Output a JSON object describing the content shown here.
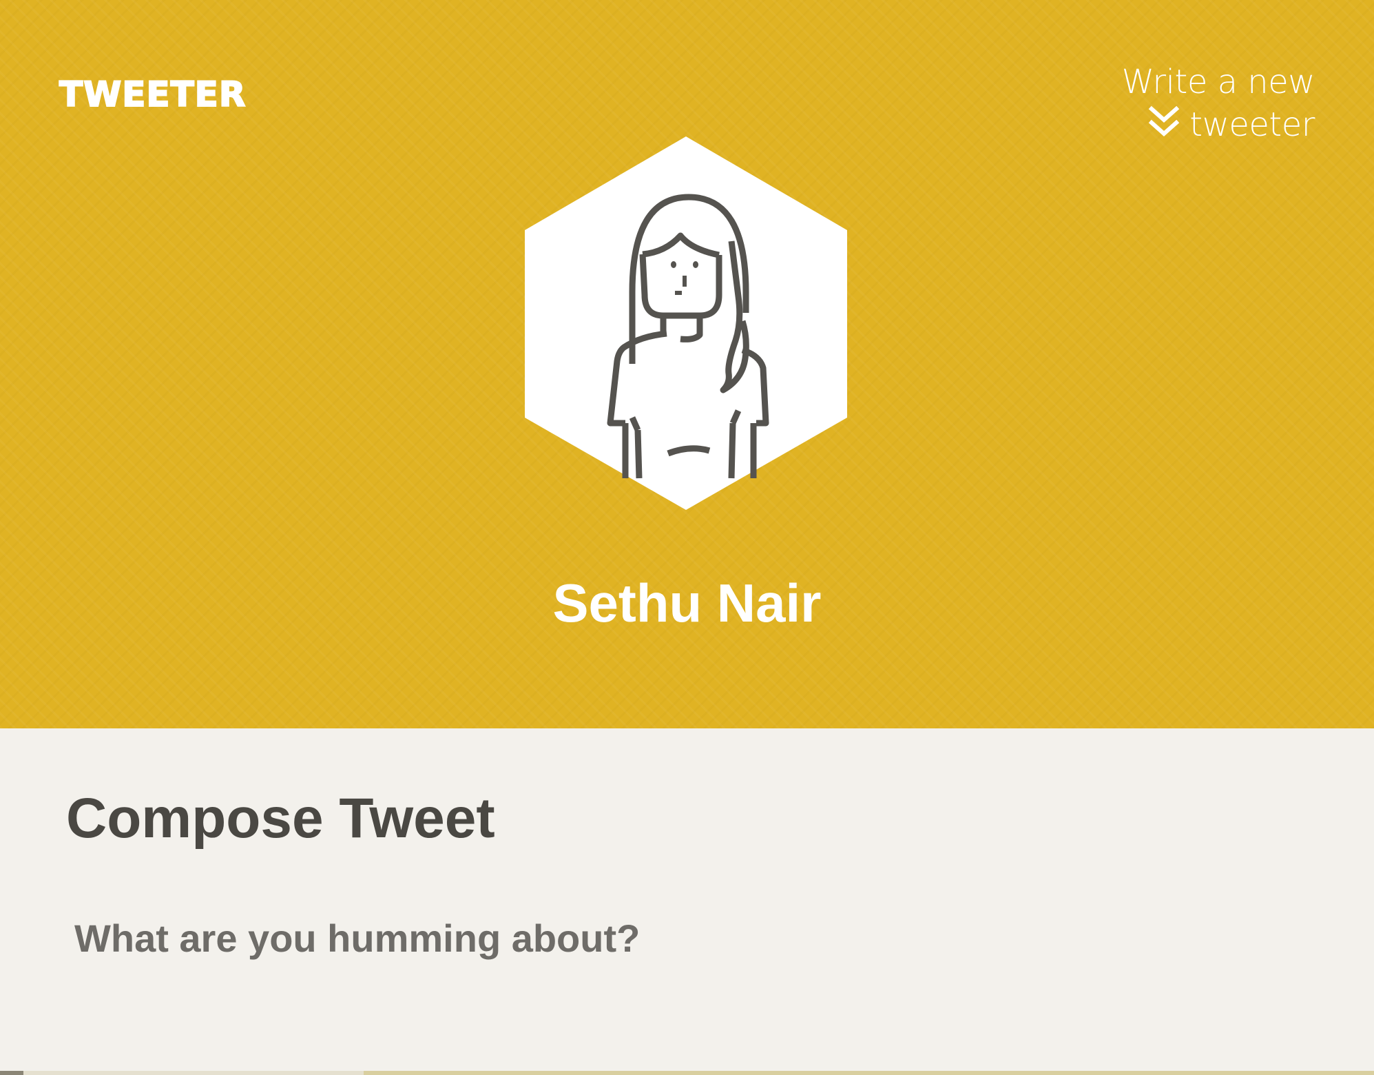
{
  "app": {
    "brand": "TWEETER"
  },
  "header": {
    "new_tweeter_link": "Write a new tweeter",
    "chevron_icon": "double-chevron-down-icon",
    "background_color": "#e0b323",
    "avatar_icon": "woman-avatar-icon",
    "user_name": "Sethu Nair"
  },
  "compose": {
    "title": "Compose Tweet",
    "placeholder": "What are you humming about?",
    "value": ""
  }
}
